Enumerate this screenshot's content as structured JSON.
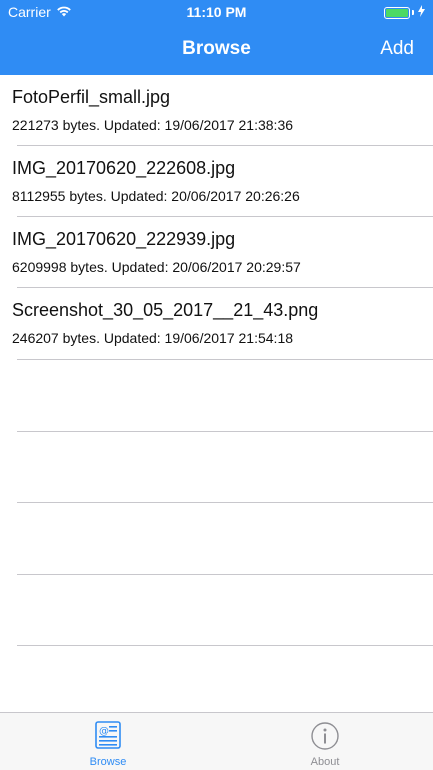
{
  "status": {
    "carrier": "Carrier",
    "time": "11:10 PM"
  },
  "nav": {
    "title": "Browse",
    "add_label": "Add"
  },
  "files": [
    {
      "name": "FotoPerfil_small.jpg",
      "meta": "221273 bytes. Updated: 19/06/2017 21:38:36"
    },
    {
      "name": "IMG_20170620_222608.jpg",
      "meta": "8112955 bytes. Updated: 20/06/2017 20:26:26"
    },
    {
      "name": "IMG_20170620_222939.jpg",
      "meta": "6209998 bytes. Updated: 20/06/2017 20:29:57"
    },
    {
      "name": "Screenshot_30_05_2017__21_43.png",
      "meta": "246207 bytes. Updated: 19/06/2017 21:54:18"
    }
  ],
  "tabs": [
    {
      "label": "Browse",
      "icon": "browse-icon",
      "active": true
    },
    {
      "label": "About",
      "icon": "info-icon",
      "active": false
    }
  ],
  "colors": {
    "accent": "#2f8cf4",
    "battery": "#4cd964",
    "separator": "#c8c7cc"
  }
}
